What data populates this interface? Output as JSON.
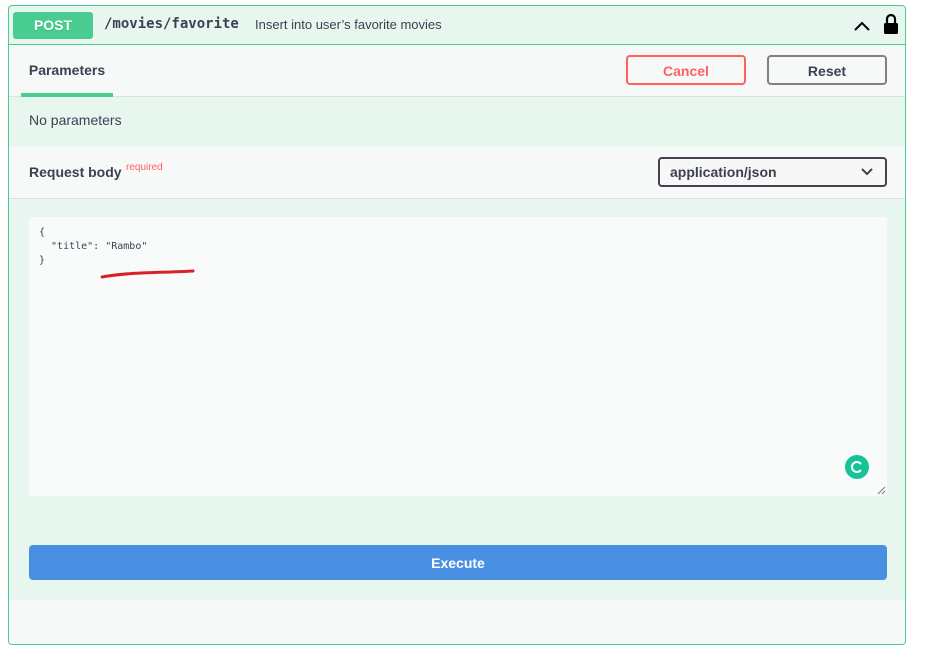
{
  "operation": {
    "method": "POST",
    "path": "/movies/favorite",
    "summary": "Insert into user’s favorite movies"
  },
  "tabs": {
    "parameters": "Parameters",
    "cancel": "Cancel",
    "reset": "Reset"
  },
  "parameters": {
    "empty": "No parameters"
  },
  "request_body": {
    "title": "Request body",
    "required": "required",
    "content_type": "application/json",
    "code": "{\n  \"title\": \"Rambo\"\n}"
  },
  "actions": {
    "execute": "Execute"
  },
  "icons": {
    "collapse": "chevron-up-icon",
    "lock": "lock-icon",
    "select_arrow": "chevron-down-icon",
    "grammarly": "grammarly-icon",
    "resize": "resize-grip-icon"
  },
  "colors": {
    "post": "#49cc90",
    "cancel": "#ff6060",
    "execute": "#4990e2",
    "annotation": "#d9202a",
    "grammarly": "#15c39a"
  }
}
